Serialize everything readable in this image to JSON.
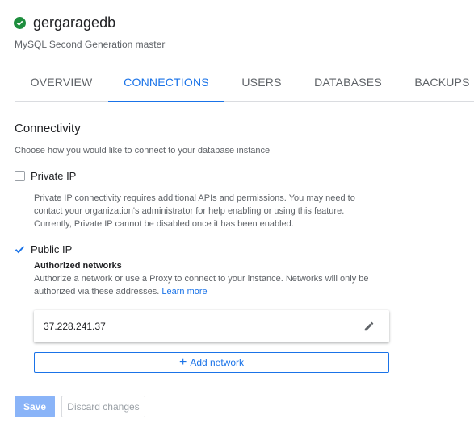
{
  "instance": {
    "name": "gergaragedb",
    "subtitle": "MySQL Second Generation master",
    "status_color": "#1e8e3e"
  },
  "tabs": [
    {
      "label": "OVERVIEW",
      "active": false
    },
    {
      "label": "CONNECTIONS",
      "active": true
    },
    {
      "label": "USERS",
      "active": false
    },
    {
      "label": "DATABASES",
      "active": false
    },
    {
      "label": "BACKUPS",
      "active": false
    }
  ],
  "connectivity": {
    "title": "Connectivity",
    "description": "Choose how you would like to connect to your database instance",
    "private_ip": {
      "label": "Private IP",
      "checked": false,
      "help_line1": "Private IP connectivity requires additional APIs and permissions. You may need to",
      "help_line2": "contact your organization's administrator for help enabling or using this feature.",
      "help_line3": "Currently, Private IP cannot be disabled once it has been enabled."
    },
    "public_ip": {
      "label": "Public IP",
      "checked": true,
      "authorized_title": "Authorized networks",
      "auth_line1": "Authorize a network or use a Proxy to connect to your instance. Networks will only be",
      "auth_line2": "authorized via these addresses.",
      "learn_more": "Learn more",
      "networks": [
        "37.228.241.37"
      ],
      "add_network_label": "Add network"
    }
  },
  "actions": {
    "save_label": "Save",
    "discard_label": "Discard changes"
  },
  "colors": {
    "accent": "#1a73e8",
    "save_disabled": "#8ab4f8"
  },
  "icons": {
    "status": "check-circle-icon",
    "edit": "pencil-icon",
    "add": "plus-icon"
  }
}
